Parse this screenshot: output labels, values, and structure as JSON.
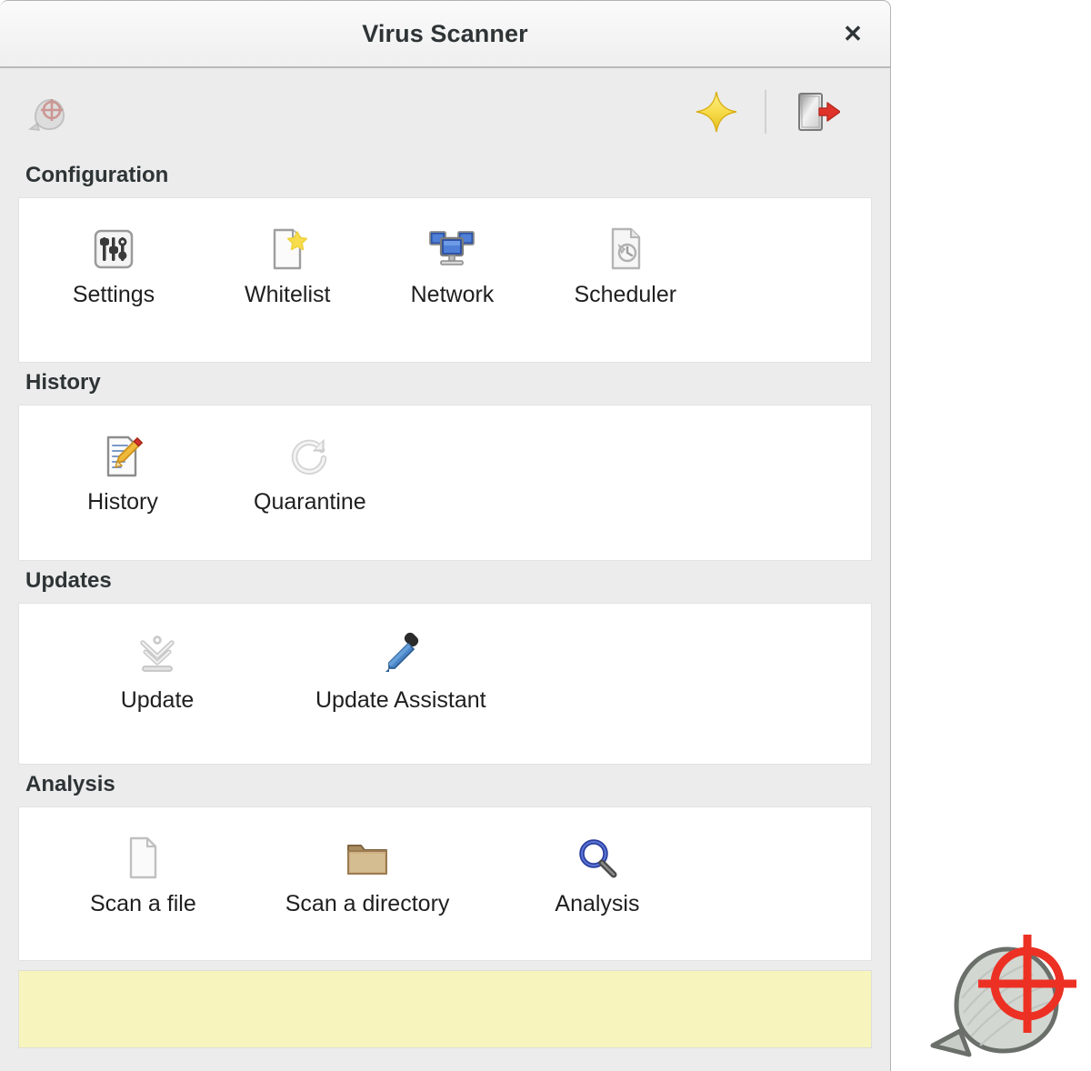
{
  "window": {
    "title": "Virus Scanner",
    "close_label": "✕"
  },
  "toolbar": {
    "items": [
      {
        "name": "app-logo-icon",
        "label": "Virus Scanner"
      },
      {
        "name": "new-scan-star-icon",
        "label": "New"
      },
      {
        "name": "quit-icon",
        "label": "Quit"
      }
    ]
  },
  "sections": [
    {
      "id": "configuration",
      "label": "Configuration",
      "items": [
        {
          "label": "Settings",
          "icon": "settings-sliders-icon"
        },
        {
          "label": "Whitelist",
          "icon": "document-star-icon"
        },
        {
          "label": "Network",
          "icon": "network-monitors-icon"
        },
        {
          "label": "Scheduler",
          "icon": "document-clock-icon"
        }
      ]
    },
    {
      "id": "history",
      "label": "History",
      "items": [
        {
          "label": "History",
          "icon": "document-pencil-icon"
        },
        {
          "label": "Quarantine",
          "icon": "refresh-circle-icon"
        }
      ]
    },
    {
      "id": "updates",
      "label": "Updates",
      "items": [
        {
          "label": "Update",
          "icon": "download-tray-icon"
        },
        {
          "label": "Update Assistant",
          "icon": "eyedropper-icon"
        }
      ]
    },
    {
      "id": "analysis",
      "label": "Analysis",
      "items": [
        {
          "label": "Scan a file",
          "icon": "blank-document-icon"
        },
        {
          "label": "Scan a directory",
          "icon": "folder-icon"
        },
        {
          "label": "Analysis",
          "icon": "magnifier-icon"
        }
      ]
    }
  ],
  "status_panel": {
    "text": "",
    "background_color": "#f7f5bd"
  },
  "desktop": {
    "logo_name": "virus-crosshair-logo"
  },
  "colors": {
    "window_background": "#ececec",
    "card_background": "#ffffff",
    "title_text": "#2e3436",
    "accent_red": "#e8372b",
    "accent_yellow": "#f5d93b",
    "accent_blue": "#2a52a5"
  }
}
